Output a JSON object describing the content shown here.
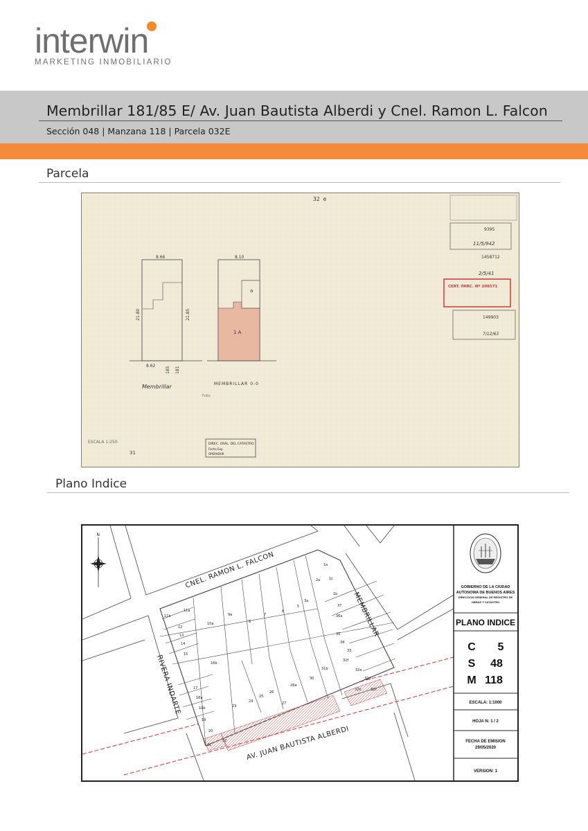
{
  "logo": {
    "word": "interwin",
    "tagline": "MARKETING INMOBILIARIO"
  },
  "header": {
    "title": "Membrillar 181/85 E/ Av. Juan Bautista Alberdi y Cnel. Ramon L. Falcon",
    "subtitle": "Sección 048 | Manzana  118 | Parcela 032E"
  },
  "sections": {
    "parcela": "Parcela",
    "plano": "Plano Indice"
  },
  "colors": {
    "orange": "#f38a3c",
    "band_gray": "#c8c8c8",
    "parcel_fill": "#e8b9a0"
  },
  "parcela_doc": {
    "top_code": "32 e",
    "street_left": "Membrillar",
    "street_right": "MEMBRILLAR 0-0",
    "dims_left_top": "8.66",
    "dims_left_side1": "21.80",
    "dims_left_side2": "21.85",
    "dims_left_bottom": "8.62",
    "num_185": "185",
    "num_181": "181",
    "dims_right_top": "8.10",
    "lot_label": "1  A",
    "lot_label_a": "a",
    "stamp1": "DIREC. GRAL. DEL CATASTRO",
    "stamp1_line2": "Fecha  Exp.",
    "stamp1_line3": "OPERADOR",
    "escala": "ESCALA 1:250",
    "stamp_right1": "9395",
    "stamp_right2": "11/5/942",
    "stamp_right3": "1458712",
    "stamp_right4": "2/5/41",
    "stamp_red": "CERT. PARC. Nº 208571",
    "stamp_right5": "149903",
    "stamp_right6": "7/12/63",
    "folio": "Folio",
    "year": "31"
  },
  "plano": {
    "streets": {
      "north": "CNEL. RAMON L. FALCON",
      "east": "MEMBRILLAR",
      "south": "AV. JUAN BAUTISTA ALBERDI",
      "west": "RIVERA INDARTE"
    },
    "compass": "N",
    "gov_line1": "GOBIERNO DE LA CIUDAD",
    "gov_line2": "AUTONOMA DE BUENOS AIRES",
    "gov_line3": "DIRECCION GENERAL DE REGISTRO DE",
    "gov_line4": "OBRAS Y CATASTRO",
    "title": "PLANO INDICE",
    "c_label": "C",
    "c_val": "5",
    "s_label": "S",
    "s_val": "48",
    "m_label": "M",
    "m_val": "118",
    "escala": "ESCALA:  1:1000",
    "hoja": "HOJA N:   1 / 2",
    "fecha_label": "FECHA DE EMISION",
    "fecha": "29/05/2020",
    "version": "VERSION: 1",
    "parcels": [
      "11b",
      "11a",
      "12",
      "13",
      "14",
      "15",
      "10a",
      "9a",
      "8",
      "7",
      "6",
      "5",
      "3a",
      "2a",
      "1a",
      "1c",
      "1b",
      "37",
      "36a",
      "35",
      "34",
      "33",
      "32f",
      "32e",
      "32d",
      "32c",
      "32b",
      "16b",
      "17",
      "18a",
      "18b",
      "19",
      "20",
      "21",
      "22",
      "23",
      "24",
      "25",
      "26",
      "27",
      "28a",
      "30",
      "31b"
    ]
  }
}
